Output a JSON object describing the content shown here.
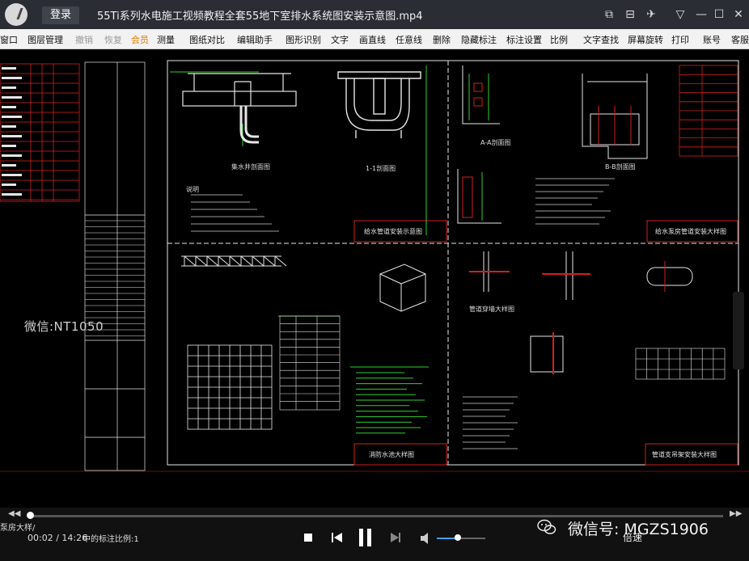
{
  "titlebar": {
    "login_label": "登录",
    "file_title": "55Ti系列水电施工视频教程全套55地下室排水系统图安装示意图.mp4",
    "controls": [
      "⧉",
      "⊟",
      "✈",
      "▽",
      "—",
      "☐",
      "✕"
    ]
  },
  "menubar": {
    "items": [
      {
        "label": "窗口",
        "state": "normal"
      },
      {
        "label": "图层管理",
        "state": "normal"
      },
      {
        "label": "撤销",
        "state": "disabled"
      },
      {
        "label": "恢复",
        "state": "disabled"
      },
      {
        "label": "会员",
        "state": "highlight"
      },
      {
        "label": "测量",
        "state": "normal"
      },
      {
        "label": "图纸对比",
        "state": "normal"
      },
      {
        "label": "编辑助手",
        "state": "normal"
      },
      {
        "label": "图形识别",
        "state": "normal"
      },
      {
        "label": "文字",
        "state": "normal"
      },
      {
        "label": "画直线",
        "state": "normal"
      },
      {
        "label": "任意线",
        "state": "normal"
      },
      {
        "label": "删除",
        "state": "normal"
      },
      {
        "label": "隐藏标注",
        "state": "normal"
      },
      {
        "label": "标注设置",
        "state": "normal"
      },
      {
        "label": "比例",
        "state": "normal"
      },
      {
        "label": "文字查找",
        "state": "normal"
      },
      {
        "label": "屏幕旋转",
        "state": "normal"
      },
      {
        "label": "打印",
        "state": "normal"
      },
      {
        "label": "账号",
        "state": "normal"
      },
      {
        "label": "客服",
        "state": "normal"
      }
    ]
  },
  "drawing": {
    "watermark": "微信:NT1050",
    "titles": [
      "给水管道安装示意图",
      "给水泵房管道安装大样图",
      "集水井剖面图",
      "消防水池大样图",
      "管道穿墙大样图",
      "管道支吊架安装大样图",
      "说明",
      "1-1剖面图",
      "A-A剖面图",
      "B-B剖面图"
    ]
  },
  "player": {
    "subtitle_left": "泵房大样/",
    "subtitle_mid": "中的标注比例:1",
    "current_time": "00:02",
    "separator": " / ",
    "total_time": "14:26",
    "progress": 0.004,
    "volume": 0.45,
    "skip_back": "◀◀",
    "skip_forward": "▶▶",
    "speed_label": "倍速",
    "wechat_label": "微信号: MGZS1906"
  },
  "colors": {
    "titlebar": "#2a2d33",
    "cad_red": "#d02020",
    "cad_green": "#2fd02f",
    "cad_white": "#e6e6e6",
    "accent_blue": "#3aa0ff"
  }
}
